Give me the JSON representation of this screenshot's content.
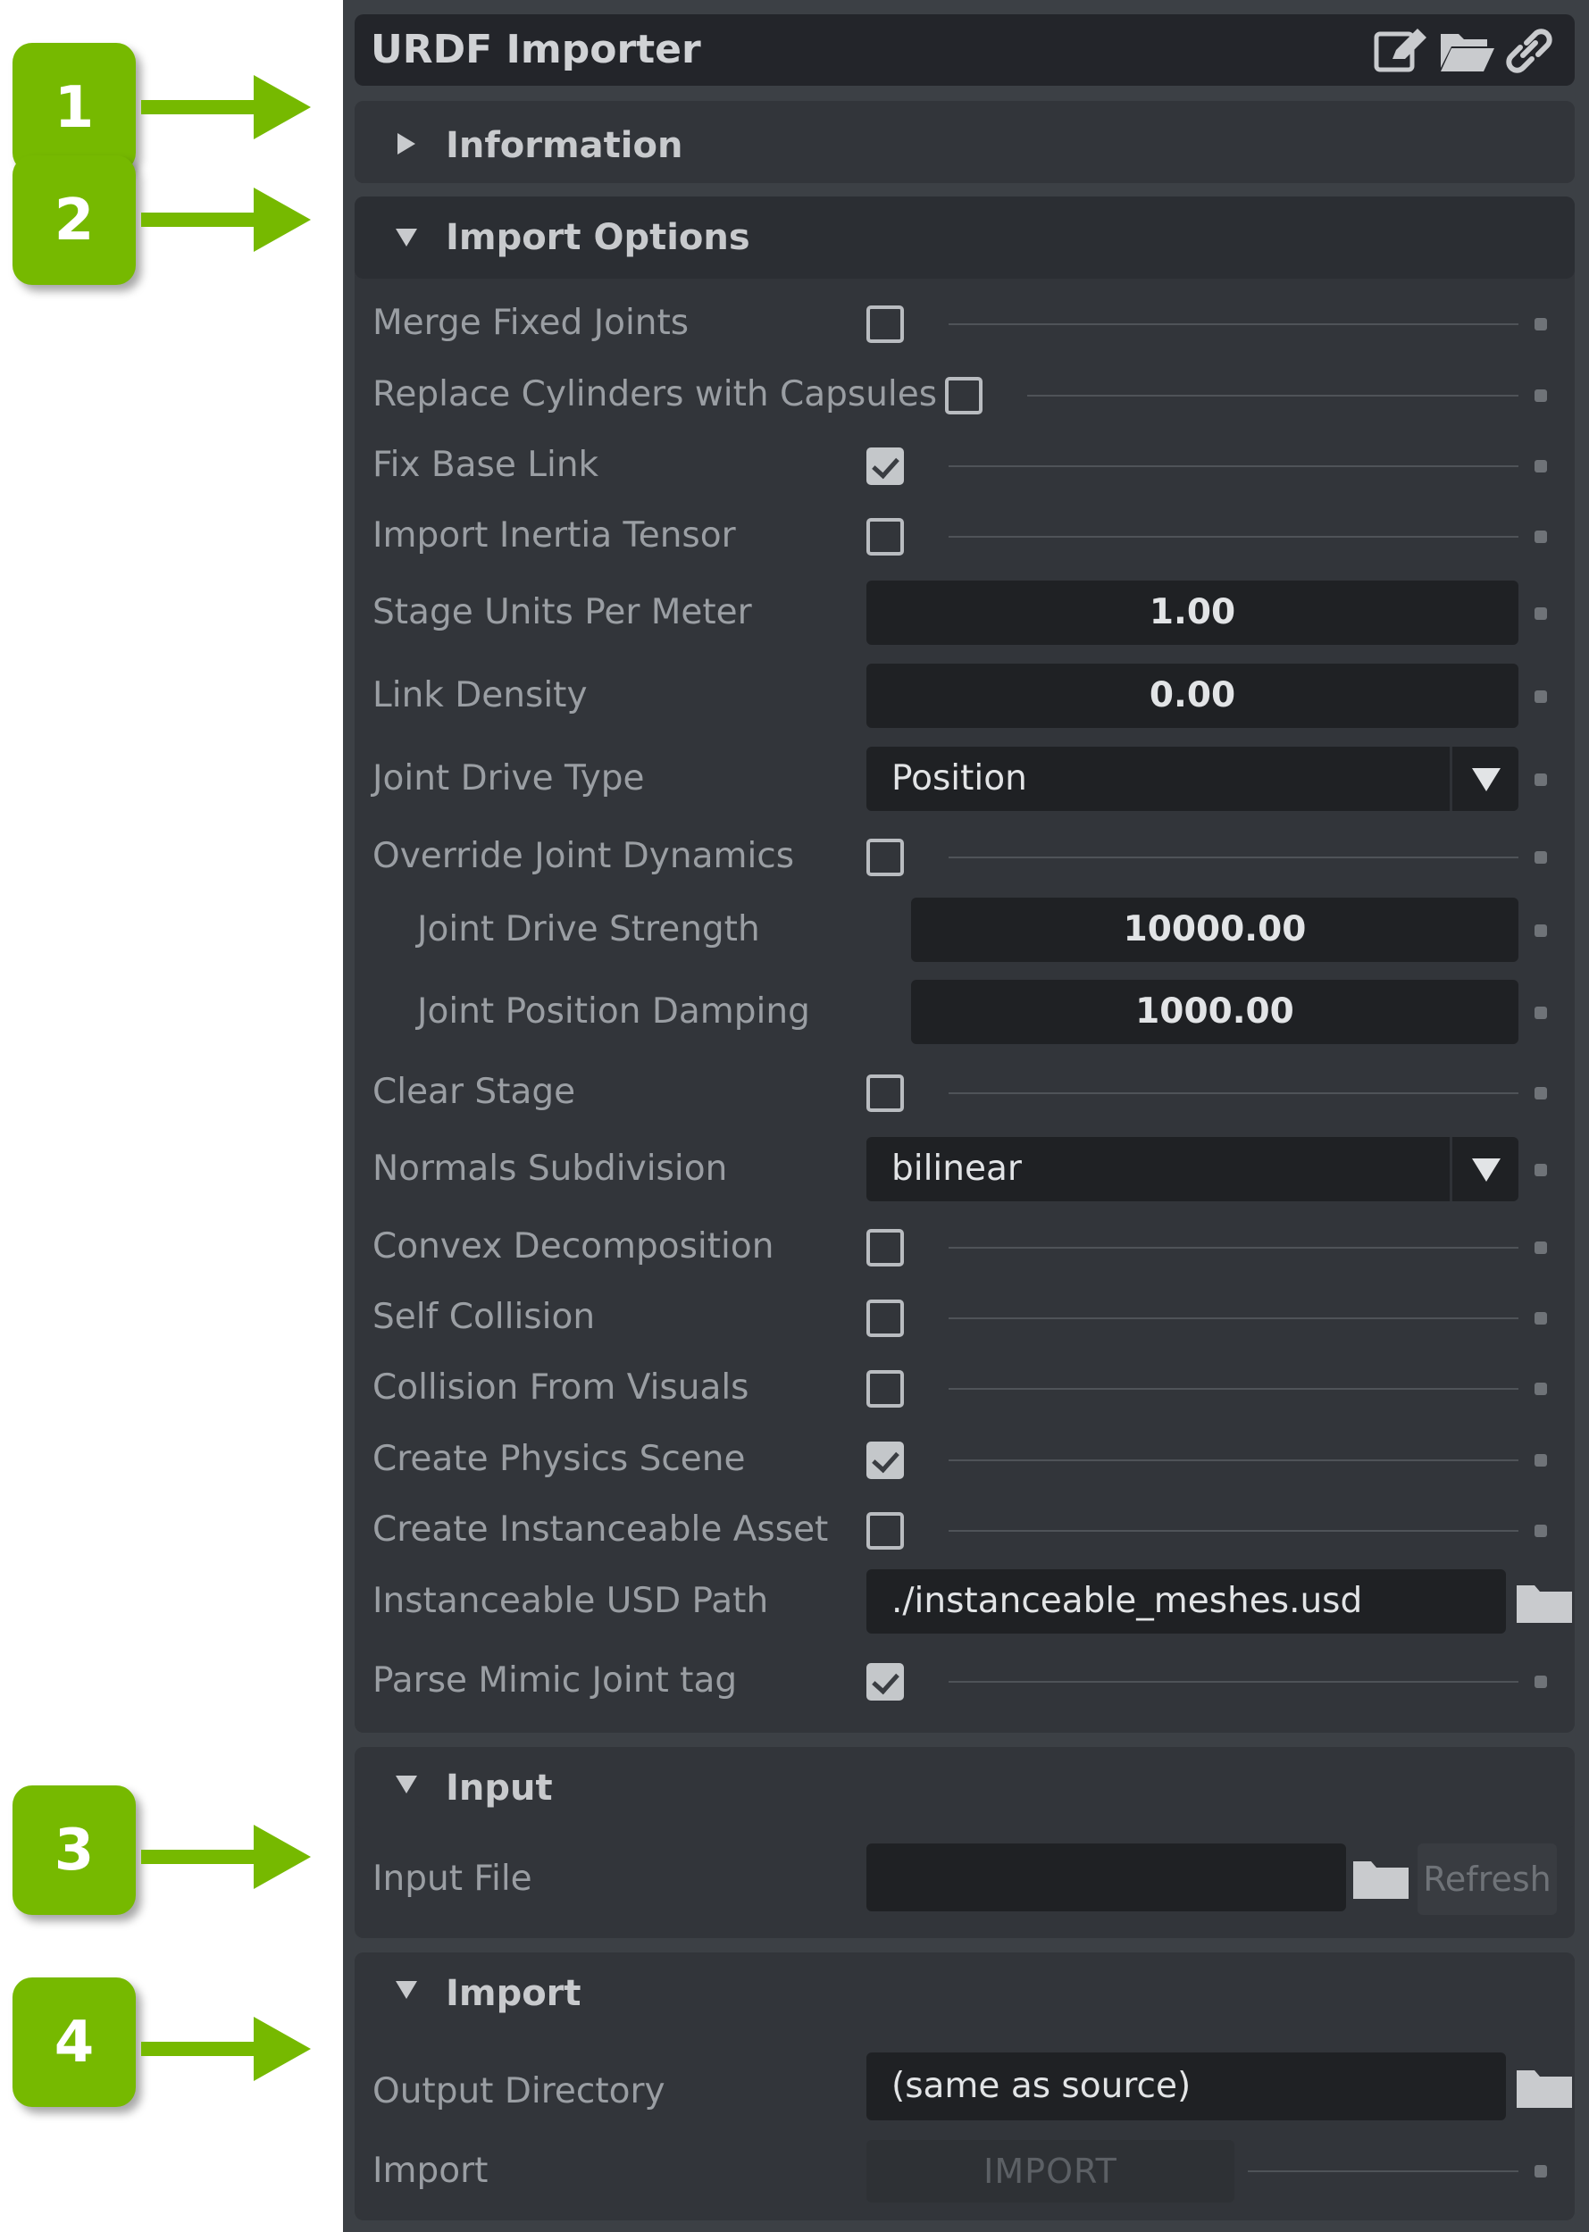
{
  "callouts": [
    {
      "number": "1"
    },
    {
      "number": "2"
    },
    {
      "number": "3"
    },
    {
      "number": "4"
    }
  ],
  "header": {
    "title": "URDF Importer",
    "icons": [
      "edit-icon",
      "folder-open-icon",
      "link-icon"
    ]
  },
  "sections": {
    "information": {
      "label": "Information",
      "expanded": false
    },
    "import_options": {
      "label": "Import Options",
      "expanded": true
    },
    "input": {
      "label": "Input",
      "expanded": true
    },
    "import": {
      "label": "Import",
      "expanded": true
    }
  },
  "options": {
    "merge_fixed_joints": {
      "label": "Merge Fixed Joints",
      "checked": false
    },
    "replace_cylinders": {
      "label": "Replace Cylinders with Capsules",
      "checked": false
    },
    "fix_base_link": {
      "label": "Fix Base Link",
      "checked": true
    },
    "import_inertia": {
      "label": "Import Inertia Tensor",
      "checked": false
    },
    "stage_units": {
      "label": "Stage Units Per Meter",
      "value": "1.00"
    },
    "link_density": {
      "label": "Link Density",
      "value": "0.00"
    },
    "joint_drive_type": {
      "label": "Joint Drive Type",
      "value": "Position"
    },
    "override_dynamics": {
      "label": "Override Joint Dynamics",
      "checked": false
    },
    "joint_drive_strength": {
      "label": "Joint Drive Strength",
      "value": "10000.00"
    },
    "joint_position_damping": {
      "label": "Joint Position Damping",
      "value": "1000.00"
    },
    "clear_stage": {
      "label": "Clear Stage",
      "checked": false
    },
    "normals_subdivision": {
      "label": "Normals Subdivision",
      "value": "bilinear"
    },
    "convex_decomposition": {
      "label": "Convex Decomposition",
      "checked": false
    },
    "self_collision": {
      "label": "Self Collision",
      "checked": false
    },
    "collision_from_visuals": {
      "label": "Collision From Visuals",
      "checked": false
    },
    "create_physics_scene": {
      "label": "Create Physics Scene",
      "checked": true
    },
    "create_instanceable": {
      "label": "Create Instanceable Asset",
      "checked": false
    },
    "instanceable_path": {
      "label": "Instanceable USD Path",
      "value": "./instanceable_meshes.usd"
    },
    "parse_mimic": {
      "label": "Parse Mimic Joint tag",
      "checked": true
    }
  },
  "input": {
    "input_file": {
      "label": "Input File",
      "value": ""
    },
    "refresh_label": "Refresh"
  },
  "import": {
    "output_directory": {
      "label": "Output Directory",
      "value": "(same as source)"
    },
    "import_row_label": "Import",
    "import_button_label": "IMPORT"
  },
  "colors": {
    "callout_green": "#76b900",
    "panel_bg": "#3c4045",
    "field_bg": "#1f2124"
  }
}
